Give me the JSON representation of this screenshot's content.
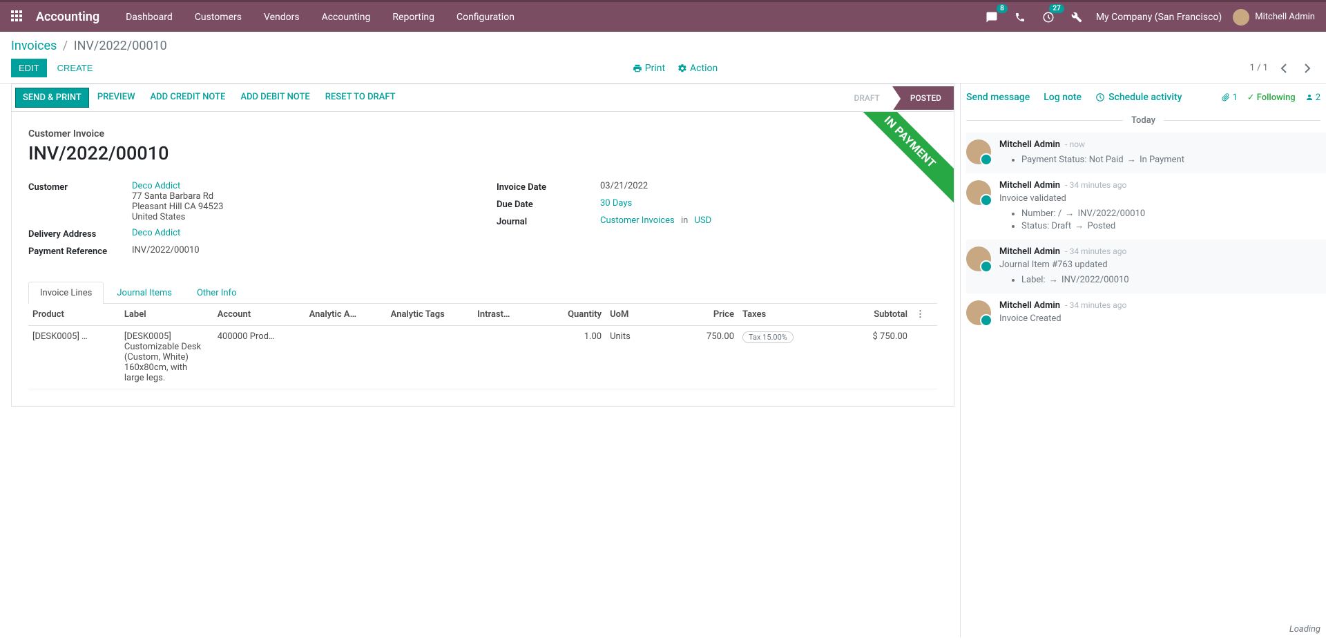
{
  "nav": {
    "app": "Accounting",
    "items": [
      "Dashboard",
      "Customers",
      "Vendors",
      "Accounting",
      "Reporting",
      "Configuration"
    ],
    "messages_badge": "8",
    "activities_badge": "27",
    "company": "My Company (San Francisco)",
    "user": "Mitchell Admin"
  },
  "breadcrumb": {
    "parent": "Invoices",
    "current": "INV/2022/00010"
  },
  "actions": {
    "edit": "EDIT",
    "create": "CREATE",
    "print": "Print",
    "action": "Action",
    "pager": "1 / 1"
  },
  "statusbar": {
    "buttons": [
      "SEND & PRINT",
      "PREVIEW",
      "ADD CREDIT NOTE",
      "ADD DEBIT NOTE",
      "RESET TO DRAFT"
    ],
    "steps": {
      "draft": "DRAFT",
      "posted": "POSTED"
    }
  },
  "ribbon": "IN PAYMENT",
  "doc": {
    "type": "Customer Invoice",
    "name": "INV/2022/00010",
    "customer_label": "Customer",
    "customer": "Deco Addict",
    "addr1": "77 Santa Barbara Rd",
    "addr2": "Pleasant Hill CA 94523",
    "addr3": "United States",
    "delivery_label": "Delivery Address",
    "delivery": "Deco Addict",
    "payref_label": "Payment Reference",
    "payref": "INV/2022/00010",
    "invdate_label": "Invoice Date",
    "invdate": "03/21/2022",
    "duedate_label": "Due Date",
    "duedate": "30 Days",
    "journal_label": "Journal",
    "journal": "Customer Invoices",
    "journal_in": "in",
    "journal_cur": "USD"
  },
  "tabs": {
    "lines": "Invoice Lines",
    "items": "Journal Items",
    "other": "Other Info"
  },
  "table": {
    "headers": {
      "product": "Product",
      "label": "Label",
      "account": "Account",
      "analytic_acc": "Analytic A…",
      "analytic_tags": "Analytic Tags",
      "intrastat": "Intrast…",
      "quantity": "Quantity",
      "uom": "UoM",
      "price": "Price",
      "taxes": "Taxes",
      "subtotal": "Subtotal"
    },
    "rows": [
      {
        "product": "[DESK0005] …",
        "label": "[DESK0005] Customizable Desk (Custom, White) 160x80cm, with large legs.",
        "account": "400000 Prod…",
        "quantity": "1.00",
        "uom": "Units",
        "price": "750.00",
        "tax": "Tax 15.00%",
        "subtotal": "$ 750.00"
      }
    ]
  },
  "chatter": {
    "send": "Send message",
    "log": "Log note",
    "schedule": "Schedule activity",
    "attach": "1",
    "following": "Following",
    "followers": "2",
    "today": "Today",
    "messages": [
      {
        "author": "Mitchell Admin",
        "time": "- now",
        "bullets": [
          "Payment Status: Not Paid → In Payment"
        ]
      },
      {
        "author": "Mitchell Admin",
        "time": "- 34 minutes ago",
        "text": "Invoice validated",
        "bullets": [
          "Number: / → INV/2022/00010",
          "Status: Draft → Posted"
        ]
      },
      {
        "author": "Mitchell Admin",
        "time": "- 34 minutes ago",
        "text": "Journal Item #763 updated",
        "bullets": [
          "Label: → INV/2022/00010"
        ]
      },
      {
        "author": "Mitchell Admin",
        "time": "- 34 minutes ago",
        "text": "Invoice Created"
      }
    ],
    "loading": "Loading"
  }
}
